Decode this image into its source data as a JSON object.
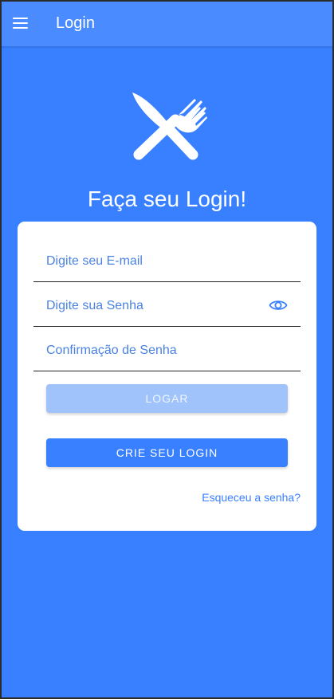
{
  "toolbar": {
    "title": "Login",
    "menu_icon": "menu-icon"
  },
  "logo_icon": "restaurant-icon",
  "heading": "Faça seu Login!",
  "form": {
    "email_placeholder": "Digite seu E-mail",
    "password_placeholder": "Digite sua Senha",
    "confirm_placeholder": "Confirmação de Senha",
    "password_toggle_icon": "eye-icon",
    "login_button": "LOGAR",
    "create_button": "CRIE SEU LOGIN",
    "forgot_link": "Esqueceu a senha?"
  },
  "colors": {
    "background": "#3880ff",
    "toolbar": "#4a8cff",
    "primary": "#3880ff",
    "disabled_button": "#a0c3fb",
    "card": "#ffffff"
  }
}
